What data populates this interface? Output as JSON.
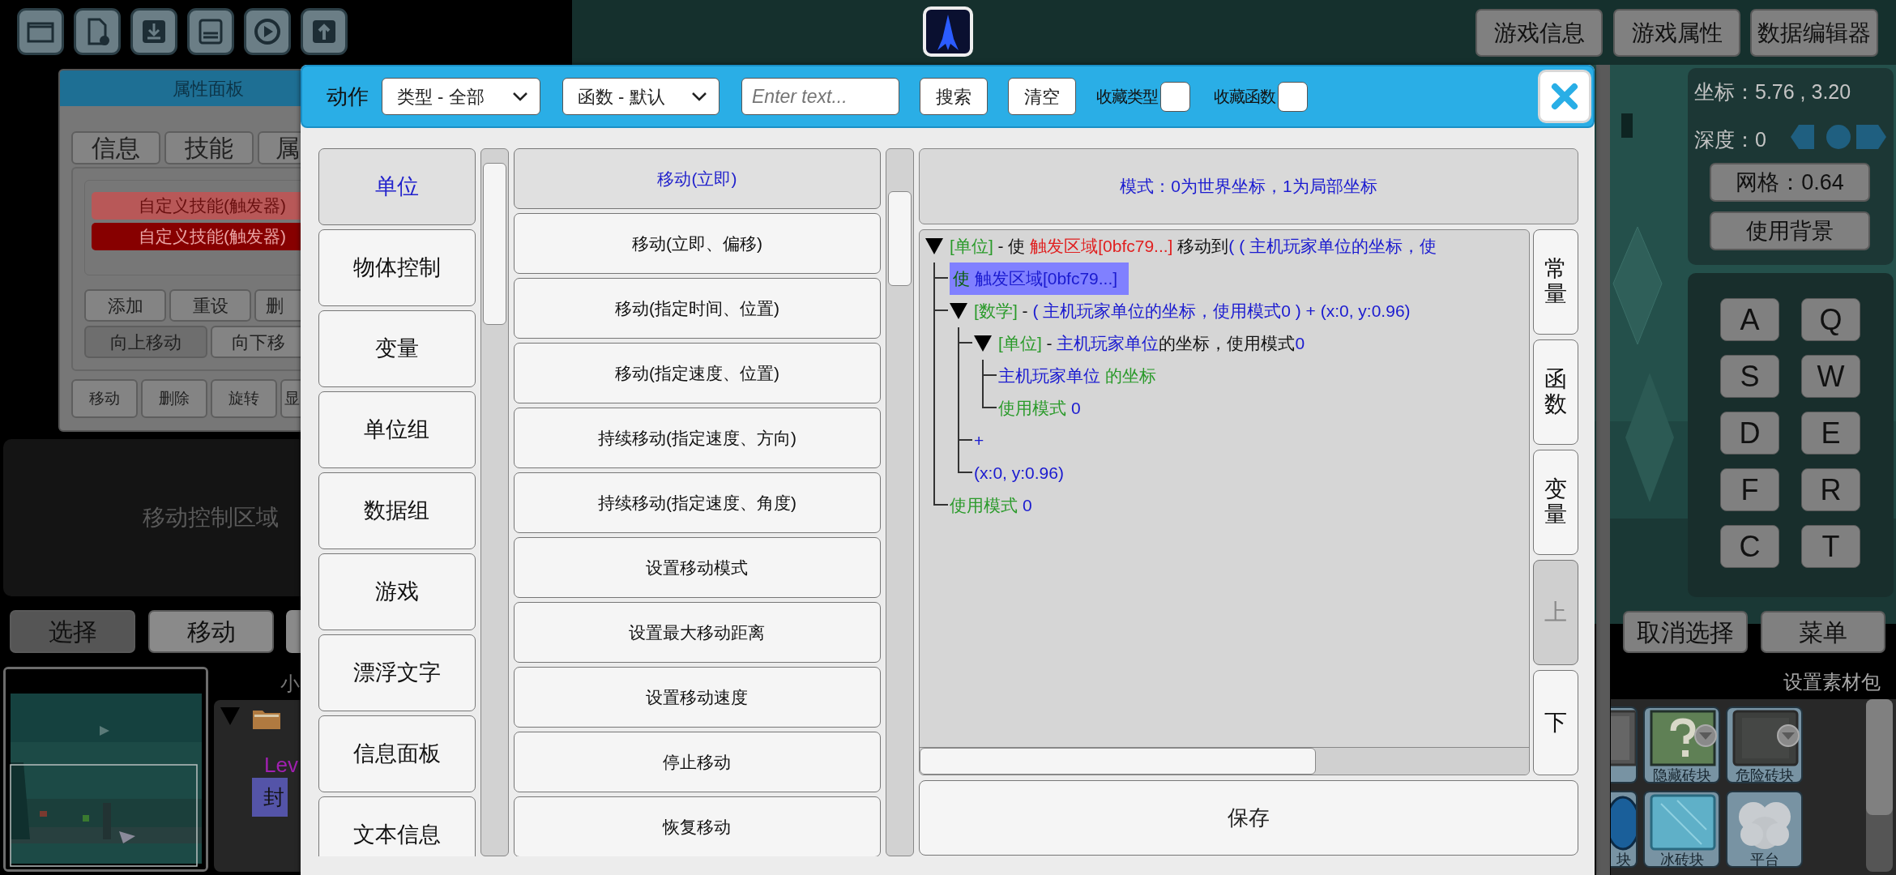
{
  "top_buttons": [
    "游戏信息",
    "游戏属性",
    "数据编辑器"
  ],
  "property_panel": {
    "title": "属性面板",
    "tabs": [
      "信息",
      "技能",
      "属"
    ],
    "skills": [
      {
        "label": "自定义技能(触发器)",
        "selected": false
      },
      {
        "label": "自定义技能(触发器)",
        "selected": true
      }
    ],
    "skill_buttons": [
      [
        {
          "label": "添加",
          "disabled": false
        },
        {
          "label": "重设",
          "disabled": false
        },
        {
          "label": "删",
          "disabled": false
        }
      ],
      [
        {
          "label": "向上移动",
          "disabled": true
        },
        {
          "label": "向下移",
          "disabled": false
        }
      ]
    ],
    "object_buttons": [
      "移动",
      "删除",
      "旋转",
      "显"
    ]
  },
  "move_area": {
    "label": "移动控制区域"
  },
  "mode_buttons": [
    {
      "label": "选择",
      "selected": true
    },
    {
      "label": "移动",
      "selected": false
    }
  ],
  "layer_label": "小",
  "object_tree": {
    "expanded": true,
    "children": [
      {
        "label": "Lev",
        "color": "#a020b0",
        "selected": false
      },
      {
        "label": "封",
        "selected": true
      }
    ]
  },
  "coordinates": "坐标：5.76 , 3.20",
  "depth": "深度：0",
  "grid_button": "网格：0.64",
  "background_button": "使用背景",
  "keys": [
    "A",
    "Q",
    "S",
    "W",
    "D",
    "E",
    "F",
    "R",
    "C",
    "T"
  ],
  "bottom_buttons": [
    "取消选择",
    "菜单"
  ],
  "asset_pack_label": "设置素材包",
  "tiles": [
    {
      "kind": "stone",
      "partial": true,
      "dropdown": false
    },
    {
      "kind": "question",
      "label": "隐藏砖块",
      "partial": false,
      "dropdown": true
    },
    {
      "kind": "dark",
      "label": "危险砖块",
      "partial": false,
      "dropdown": true
    },
    {
      "kind": "blue",
      "label": "块",
      "partial": true,
      "dropdown": false
    },
    {
      "kind": "ice",
      "label": "冰砖块",
      "partial": false,
      "dropdown": false
    },
    {
      "kind": "cloud",
      "label": "平台",
      "partial": false,
      "dropdown": false
    }
  ],
  "dialog": {
    "title": "动作",
    "type_select": "类型 - 全部",
    "function_select": "函数 - 默认",
    "search": {
      "placeholder": "Enter text..."
    },
    "buttons": [
      "搜索",
      "清空"
    ],
    "favorites": [
      {
        "label": "收藏类型",
        "checked": false
      },
      {
        "label": "收藏函数",
        "checked": false
      }
    ],
    "categories": [
      {
        "label": "单位",
        "selected": true
      },
      {
        "label": "物体控制",
        "selected": false
      },
      {
        "label": "变量",
        "selected": false
      },
      {
        "label": "单位组",
        "selected": false
      },
      {
        "label": "数据组",
        "selected": false
      },
      {
        "label": "游戏",
        "selected": false
      },
      {
        "label": "漂浮文字",
        "selected": false
      },
      {
        "label": "信息面板",
        "selected": false
      },
      {
        "label": "文本信息",
        "selected": false
      }
    ],
    "functions": [
      {
        "label": "移动(立即)",
        "selected": true
      },
      {
        "label": "移动(立即、偏移)",
        "selected": false
      },
      {
        "label": "移动(指定时间、位置)",
        "selected": false
      },
      {
        "label": "移动(指定速度、位置)",
        "selected": false
      },
      {
        "label": "持续移动(指定速度、方向)",
        "selected": false
      },
      {
        "label": "持续移动(指定速度、角度)",
        "selected": false
      },
      {
        "label": "设置移动模式",
        "selected": false
      },
      {
        "label": "设置最大移动距离",
        "selected": false
      },
      {
        "label": "设置移动速度",
        "selected": false
      },
      {
        "label": "停止移动",
        "selected": false
      },
      {
        "label": "恢复移动",
        "selected": false
      }
    ],
    "description": "模式：0为世界坐标，1为局部坐标",
    "tree": [
      {
        "segments": [
          {
            "text": "[单位]",
            "color": "#2a9a2a"
          },
          {
            "text": " - 使 ",
            "color": "#111111"
          },
          {
            "text": "触发区域[0bfc79...]",
            "color": "#e02020"
          },
          {
            "text": " 移动到",
            "color": "#111111"
          },
          {
            "text": "( ( 主机玩家单位的坐标，使",
            "color": "#1a1ad0"
          }
        ],
        "expanded": true,
        "selected": false,
        "children": [
          {
            "segments": [
              {
                "text": "使",
                "color": "#0b5e0b"
              },
              {
                "text": " 触发区域[0bfc79...]",
                "color": "#1a1ad0"
              }
            ],
            "selected": true
          },
          {
            "segments": [
              {
                "text": "[数学]",
                "color": "#2a9a2a"
              },
              {
                "text": " - ",
                "color": "#111111"
              },
              {
                "text": "( 主机玩家单位的坐标，使用模式0 ) + (x:0, y:0.96)",
                "color": "#1a1ad0"
              }
            ],
            "expanded": true,
            "selected": false,
            "children": [
              {
                "segments": [
                  {
                    "text": "[单位]",
                    "color": "#2a9a2a"
                  },
                  {
                    "text": " - ",
                    "color": "#111111"
                  },
                  {
                    "text": "主机玩家单位",
                    "color": "#1a1ad0"
                  },
                  {
                    "text": "的坐标，使用模式",
                    "color": "#111111"
                  },
                  {
                    "text": "0",
                    "color": "#1a1ad0"
                  }
                ],
                "expanded": true,
                "selected": false,
                "children": [
                  {
                    "segments": [
                      {
                        "text": "主机玩家单位",
                        "color": "#1a1ad0"
                      },
                      {
                        "text": " 的坐标",
                        "color": "#2a9a2a"
                      }
                    ],
                    "selected": false
                  },
                  {
                    "segments": [
                      {
                        "text": "使用模式",
                        "color": "#2a9a2a"
                      },
                      {
                        "text": " 0",
                        "color": "#1a1ad0"
                      }
                    ],
                    "selected": false
                  }
                ]
              },
              {
                "segments": [
                  {
                    "text": "+",
                    "color": "#1a1ad0"
                  }
                ],
                "selected": false
              },
              {
                "segments": [
                  {
                    "text": "(x:0, y:0.96)",
                    "color": "#1a1ad0"
                  }
                ],
                "selected": false
              }
            ]
          },
          {
            "segments": [
              {
                "text": "使用模式",
                "color": "#2a9a2a"
              },
              {
                "text": " 0",
                "color": "#1a1ad0"
              }
            ],
            "selected": false
          }
        ]
      }
    ],
    "side_buttons": [
      {
        "label": "常量",
        "disabled": false
      },
      {
        "label": "函数",
        "disabled": false
      },
      {
        "label": "变量",
        "disabled": false
      },
      {
        "label": "上",
        "disabled": true
      },
      {
        "label": "下",
        "disabled": false
      }
    ],
    "save_button": "保存"
  }
}
